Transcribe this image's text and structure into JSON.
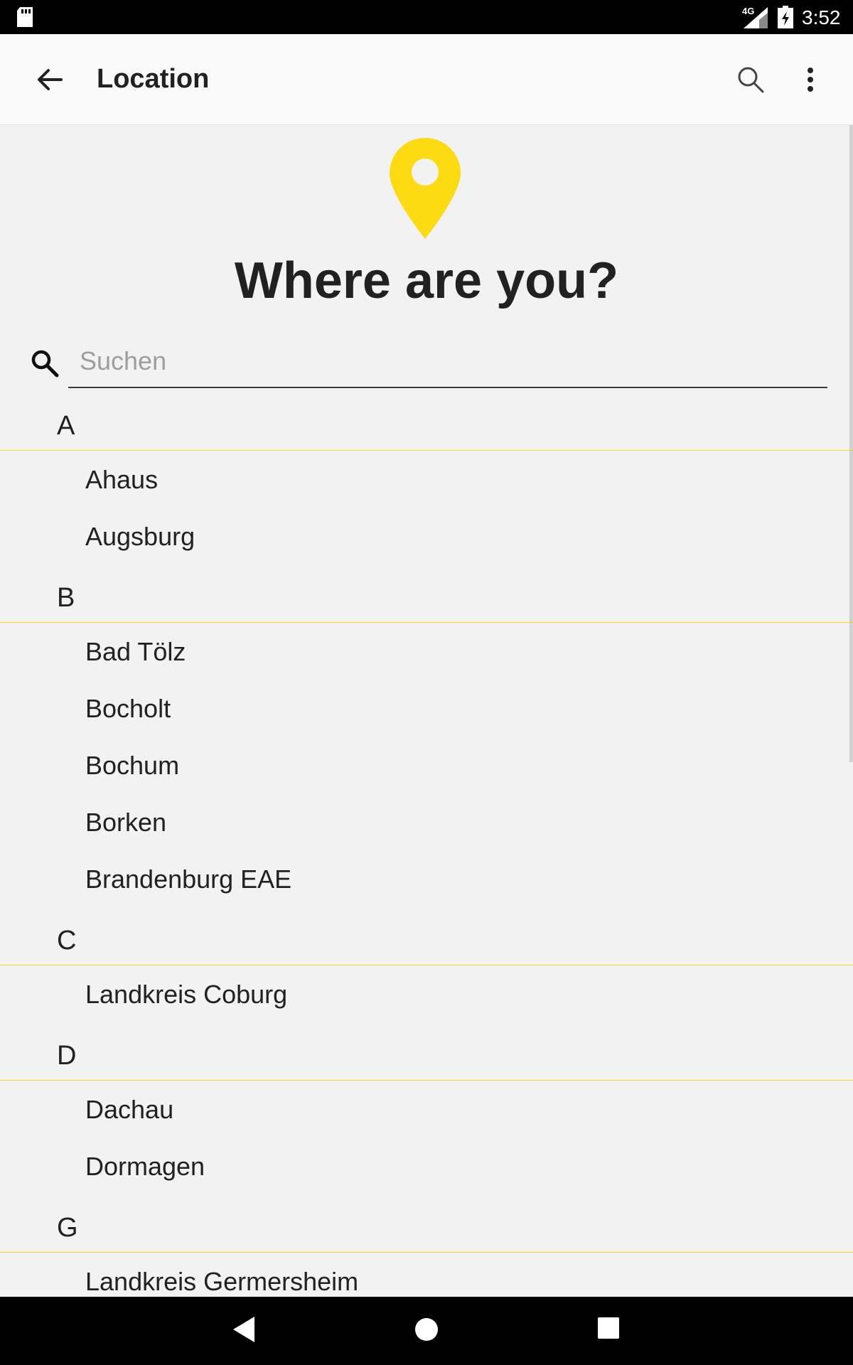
{
  "status_bar": {
    "network": "4G",
    "time": "3:52",
    "icons": [
      "sd-card-icon",
      "signal-icon",
      "battery-charging-icon"
    ]
  },
  "app_bar": {
    "title": "Location",
    "icons": [
      "arrow-back-icon",
      "search-icon",
      "more-vert-icon"
    ]
  },
  "hero": {
    "headline": "Where are you?",
    "pin_color": "#FDDB13"
  },
  "search": {
    "placeholder": "Suchen",
    "value": ""
  },
  "sections": [
    {
      "letter": "A",
      "items": [
        "Ahaus",
        "Augsburg"
      ]
    },
    {
      "letter": "B",
      "items": [
        "Bad Tölz",
        "Bocholt",
        "Bochum",
        "Borken",
        "Brandenburg EAE"
      ]
    },
    {
      "letter": "C",
      "items": [
        "Landkreis Coburg"
      ]
    },
    {
      "letter": "D",
      "items": [
        "Dachau",
        "Dormagen"
      ]
    },
    {
      "letter": "G",
      "items": [
        "Landkreis Germersheim"
      ]
    }
  ],
  "colors": {
    "accent": "#FDDB13",
    "background": "#F2F2F2",
    "divider": "#F3D51C",
    "text": "#212121"
  },
  "nav_bar": {
    "icons": [
      "nav-back-icon",
      "nav-home-icon",
      "nav-recents-icon"
    ]
  }
}
